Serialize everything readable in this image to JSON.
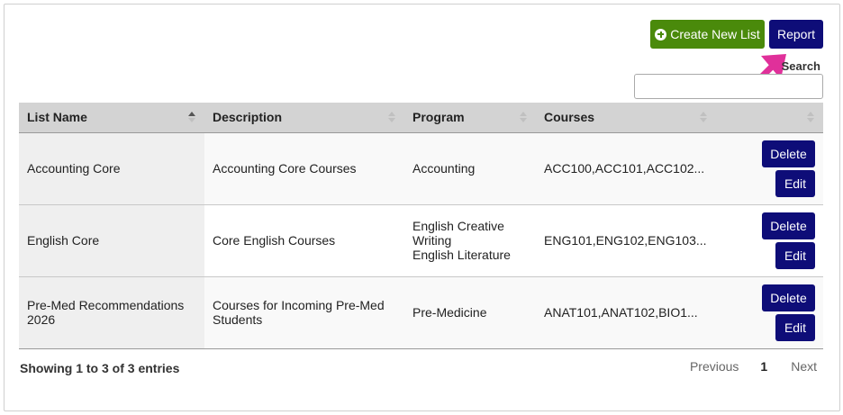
{
  "toolbar": {
    "create_label": "Create New List",
    "report_label": "Report",
    "plus_icon": "plus-circle-icon"
  },
  "search": {
    "label": "Search",
    "value": "",
    "placeholder": ""
  },
  "table": {
    "columns": [
      "List Name",
      "Description",
      "Program",
      "Courses",
      ""
    ],
    "rows": [
      {
        "list_name": "Accounting Core",
        "description": "Accounting Core Courses",
        "program": "Accounting",
        "courses": "ACC100,ACC101,ACC102...",
        "delete_label": "Delete",
        "edit_label": "Edit"
      },
      {
        "list_name": "English Core",
        "description": "Core English Courses",
        "program": "English Creative Writing\nEnglish Literature",
        "courses": "ENG101,ENG102,ENG103...",
        "delete_label": "Delete",
        "edit_label": "Edit"
      },
      {
        "list_name": "Pre-Med Recommendations 2026",
        "description": "Courses for Incoming Pre-Med Students",
        "program": "Pre-Medicine",
        "courses": "ANAT101,ANAT102,BIO1...",
        "delete_label": "Delete",
        "edit_label": "Edit"
      }
    ]
  },
  "footer": {
    "info": "Showing 1 to 3 of 3 entries",
    "prev": "Previous",
    "current_page": "1",
    "next": "Next"
  },
  "colors": {
    "create_button": "#4a8a0b",
    "report_button": "#0e0d78",
    "annotation_arrow": "#e0309a"
  }
}
